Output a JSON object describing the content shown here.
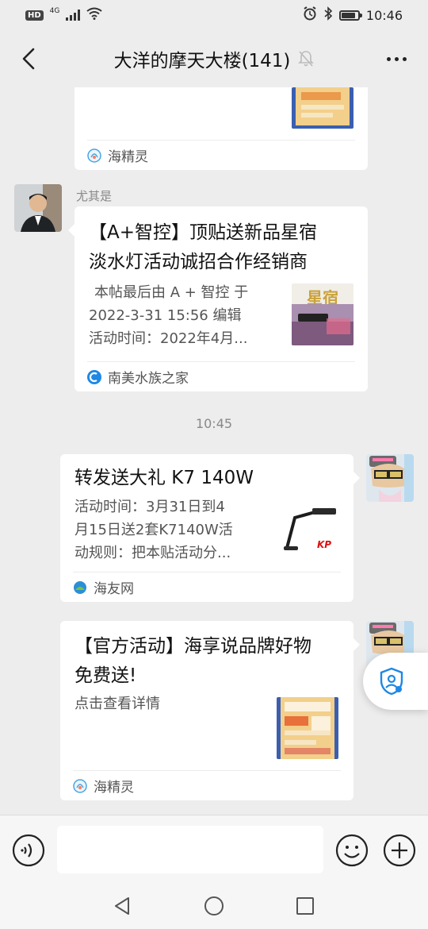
{
  "status_bar": {
    "hd": "HD",
    "network": "4G",
    "time": "10:46"
  },
  "header": {
    "title": "大洋的摩天大楼(141)"
  },
  "messages": {
    "card1": {
      "source": "海精灵"
    },
    "card2": {
      "sender": "尤其是",
      "title_line1": "【A+智控】顶贴送新品星宿",
      "title_line2": "淡水灯活动诚招合作经销商",
      "desc_line1": "本帖最后由 A + 智控 于",
      "desc_line2": "2022-3-31 15:56 编辑",
      "desc_line3": "活动时间：2022年4月...",
      "thumb_text": "星宿",
      "source": "南美水族之家"
    },
    "timestamp": "10:45",
    "card3": {
      "title": "转发送大礼 K7 140W",
      "desc_line1": "活动时间：3月31日到4",
      "desc_line2": "月15日送2套K7140W活",
      "desc_line3": "动规则：把本贴活动分...",
      "source": "海友网"
    },
    "card4": {
      "title_line1": "【官方活动】海享说品牌好物",
      "title_line2": "免费送!",
      "desc": "点击查看详情",
      "source": "海精灵"
    }
  },
  "colors": {
    "background": "#ededed",
    "card": "#ffffff",
    "accent_blue": "#1e88e5"
  }
}
